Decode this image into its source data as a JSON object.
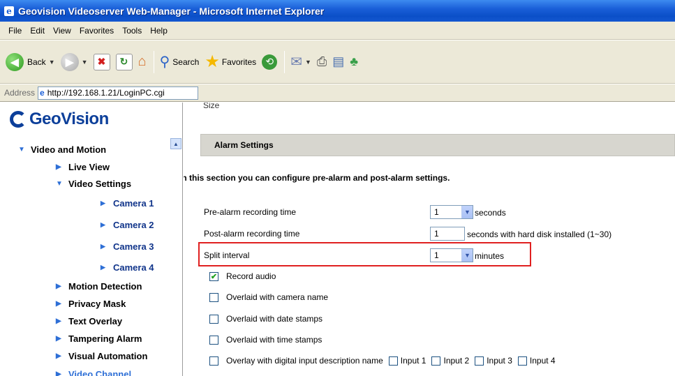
{
  "window": {
    "title": "Geovision Videoserver Web-Manager - Microsoft Internet Explorer"
  },
  "menu": [
    "File",
    "Edit",
    "View",
    "Favorites",
    "Tools",
    "Help"
  ],
  "toolbar": {
    "back_label": "Back",
    "search_label": "Search",
    "favorites_label": "Favorites"
  },
  "address": {
    "label": "Address",
    "url": "http://192.168.1.21/LoginPC.cgi"
  },
  "sidebar": {
    "logo_text": "GeoVision",
    "items": [
      {
        "label": "Video and Motion",
        "expanded": true
      },
      {
        "label": "Live View"
      },
      {
        "label": "Video Settings",
        "expanded": true
      },
      {
        "label": "Camera 1"
      },
      {
        "label": "Camera 2"
      },
      {
        "label": "Camera 3"
      },
      {
        "label": "Camera 4"
      },
      {
        "label": "Motion Detection"
      },
      {
        "label": "Privacy Mask"
      },
      {
        "label": "Text Overlay"
      },
      {
        "label": "Tampering Alarm"
      },
      {
        "label": "Visual Automation"
      },
      {
        "label": "Video Channel"
      }
    ]
  },
  "content": {
    "partial_top_text": "Size",
    "section_title": "Alarm Settings",
    "intro": "In this section you can configure pre-alarm and post-alarm settings.",
    "pre_alarm": {
      "label": "Pre-alarm recording time",
      "value": "1",
      "suffix": "seconds"
    },
    "post_alarm": {
      "label": "Post-alarm recording time",
      "value": "1",
      "suffix": "seconds with hard disk installed (1~30)"
    },
    "split_interval": {
      "label": "Split interval",
      "value": "1",
      "suffix": "minutes"
    },
    "checkboxes": [
      {
        "label": "Record audio",
        "checked": true
      },
      {
        "label": "Overlaid with camera name",
        "checked": false
      },
      {
        "label": "Overlaid with date stamps",
        "checked": false
      },
      {
        "label": "Overlaid with time stamps",
        "checked": false
      },
      {
        "label": "Overlay with digital input description name",
        "checked": false
      }
    ],
    "inputs": [
      "Input 1",
      "Input 2",
      "Input 3",
      "Input 4"
    ]
  },
  "colors": {
    "highlight_border": "#e02020",
    "section_bar": "#d7d6cf",
    "camera_link": "#10348a",
    "logo": "#0c3f9a"
  }
}
